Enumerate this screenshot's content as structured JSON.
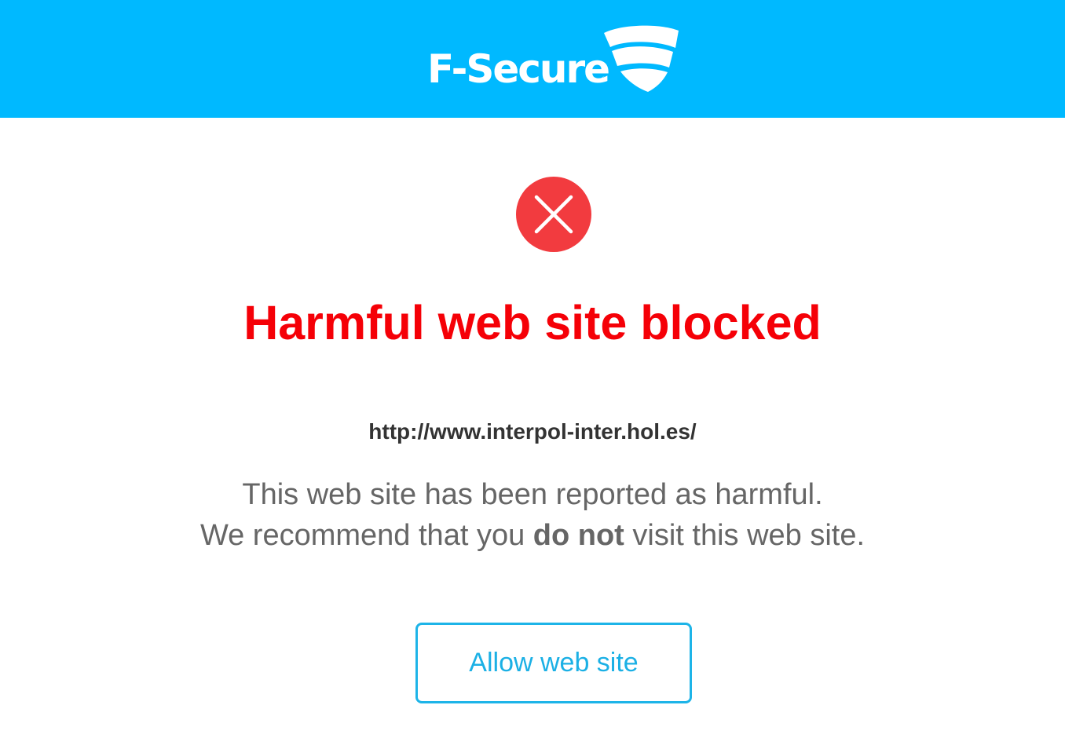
{
  "header": {
    "logo_text": "F-Secure",
    "logo_registered": "®",
    "logo_icon": "f-secure-shield-icon",
    "background_color": "#00b9ff"
  },
  "status": {
    "icon": "blocked-x-icon",
    "icon_color": "#f23b3f"
  },
  "main": {
    "title": "Harmful web site blocked",
    "title_color": "#f50007",
    "url": "http://www.interpol-inter.hol.es/",
    "message_line1": "This web site has been reported as harmful.",
    "message_line2_prefix": "We recommend that you ",
    "message_line2_emphasis": "do not",
    "message_line2_suffix": " visit this web site."
  },
  "actions": {
    "allow_label": "Allow web site",
    "accent_color": "#1db4e8"
  }
}
